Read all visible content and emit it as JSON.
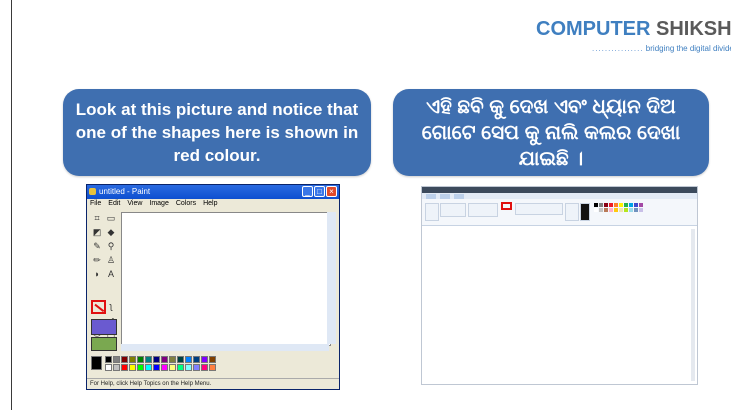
{
  "logo": {
    "part1": "COMPUTER",
    "part2": "SHIKSHA",
    "tagline": "bridging the digital divide",
    "dots": "................"
  },
  "bubbles": {
    "english": "Look at this picture and notice that one of the shapes here is shown in red colour.",
    "odia": "ଏହି ଛବି କୁ ଦେଖ ଏବଂ ଧ୍ୟାନ ଦିଅ ଗୋଟେ ସେପ କୁ ନାଲି କଲର ଦେଖା ଯାଇଛି ।"
  },
  "classic_paint": {
    "title": "untitled - Paint",
    "menu": [
      "File",
      "Edit",
      "View",
      "Image",
      "Colors",
      "Help"
    ],
    "status": "For Help, click Help Topics on the Help Menu.",
    "palette": [
      "#000000",
      "#808080",
      "#800000",
      "#808000",
      "#008000",
      "#008080",
      "#000080",
      "#800080",
      "#808040",
      "#004040",
      "#0080ff",
      "#004080",
      "#8000ff",
      "#804000",
      "#ffffff",
      "#c0c0c0",
      "#ff0000",
      "#ffff00",
      "#00ff00",
      "#00ffff",
      "#0000ff",
      "#ff00ff",
      "#ffff80",
      "#00ff80",
      "#80ffff",
      "#8080ff",
      "#ff0080",
      "#ff8040"
    ]
  },
  "ribbon_paint": {
    "colors": [
      "#000000",
      "#7f7f7f",
      "#880015",
      "#ed1c24",
      "#ff7f27",
      "#fff200",
      "#22b14c",
      "#00a2e8",
      "#3f48cc",
      "#a349a4",
      "#ffffff",
      "#c3c3c3",
      "#b97a57",
      "#ffaec9",
      "#ffc90e",
      "#efe4b0",
      "#b5e61d",
      "#99d9ea",
      "#7092be",
      "#c8bfe7"
    ]
  },
  "colors": {
    "bubble": "#3f6fb0",
    "highlight": "#e01010",
    "logo_blue": "#3f7fc0",
    "logo_gray": "#5a5a5a"
  }
}
